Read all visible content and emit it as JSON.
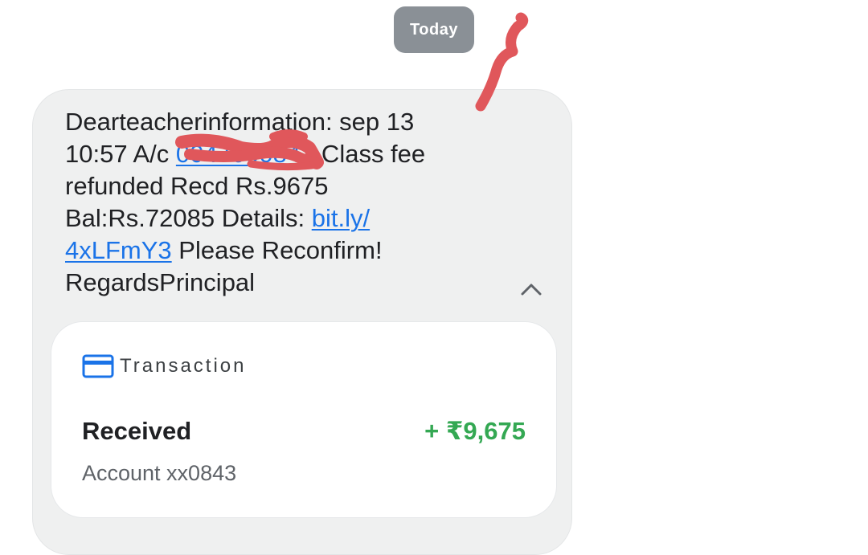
{
  "date_chip": "Today",
  "message": {
    "line1": "Dearteacherinformation: sep 13",
    "line2_prefix": "10:57 A/c ",
    "line2_link": "0047000843",
    "line2_suffix": " Class fee",
    "line3": "refunded Recd Rs.9675",
    "line4_prefix": "Bal:Rs.72085 Details: ",
    "link_part1": "bit.ly/",
    "link_part2": "4xLFmY3",
    "line5_suffix": " Please Reconfirm!",
    "line6": "RegardsPrincipal"
  },
  "card": {
    "title": "Transaction",
    "status": "Received",
    "amount": "+ ₹9,675",
    "account": "Account xx0843"
  },
  "colors": {
    "link": "#1a73e8",
    "amount": "#34a853",
    "bubble": "#eff0f0",
    "chip": "#8a9096",
    "scribble": "#e0575b"
  },
  "icons": {
    "collapse": "chevron-up-icon",
    "card": "credit-card-icon"
  }
}
